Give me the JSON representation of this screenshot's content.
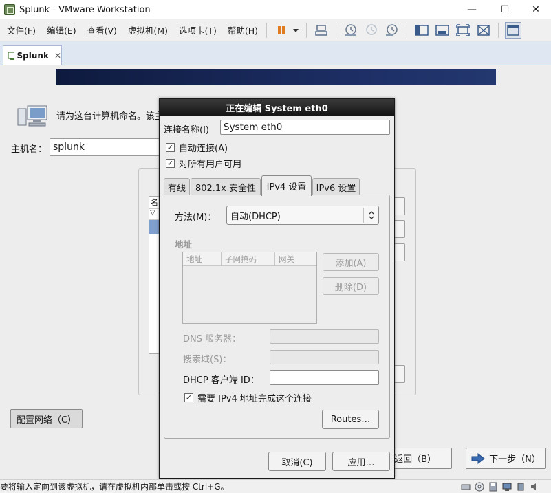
{
  "window": {
    "title": "Splunk - VMware Workstation",
    "minimize": "—",
    "maximize": "☐",
    "close": "✕"
  },
  "menu": {
    "items": [
      "文件(F)",
      "编辑(E)",
      "查看(V)",
      "虚拟机(M)",
      "选项卡(T)",
      "帮助(H)"
    ]
  },
  "toolbar_icons": [
    "pause-icon",
    "dropdown-arrow-icon",
    "send-keys-icon",
    "snapshot-take-icon",
    "snapshot-revert-icon",
    "snapshot-manager-icon",
    "sidebar-toggle-icon",
    "console-view-icon",
    "fullscreen-icon",
    "unity-icon",
    "thumbnail-view-icon"
  ],
  "tab": {
    "label": "Splunk",
    "close": "✕"
  },
  "installer": {
    "prompt": "请为这台计算机命名。该主",
    "hostname_label": "主机名：",
    "hostname_value": "splunk",
    "list_header": "名",
    "list_row2": "▽",
    "config_network_button": "配置网络（C）",
    "back_button": "返回（B）",
    "next_button": "下一步（N）"
  },
  "dialog": {
    "title": "正在编辑 System eth0",
    "connection_name_label": "连接名称(I)",
    "connection_name_value": "System eth0",
    "auto_connect_label": "自动连接(A)",
    "auto_connect_checked": true,
    "all_users_label": "对所有用户可用",
    "all_users_checked": true,
    "tabs": [
      "有线",
      "802.1x 安全性",
      "IPv4 设置",
      "IPv6 设置"
    ],
    "active_tab": "IPv4 设置",
    "method_label": "方法(M)：",
    "method_value": "自动(DHCP)",
    "address_section_label": "地址",
    "address_columns": [
      "地址",
      "子网掩码",
      "网关"
    ],
    "add_button": "添加(A)",
    "delete_button": "删除(D)",
    "dns_label": "DNS 服务器：",
    "search_domain_label": "搜索域(S)：",
    "dhcp_client_id_label": "DHCP 客户端 ID：",
    "require_ipv4_label": "需要 IPv4 地址完成这个连接",
    "require_ipv4_checked": true,
    "routes_button": "Routes…",
    "cancel_button": "取消(C)",
    "apply_button": "应用…"
  },
  "status_bar": {
    "text": "要将输入定向到该虚拟机，请在虚拟机内部单击或按 Ctrl+G。"
  },
  "colors": {
    "banner": "#1d2f66",
    "dialog_title_bg": "#151515",
    "tab_bar": "#dfe7f3",
    "pause_icon": "#e07b1f"
  }
}
